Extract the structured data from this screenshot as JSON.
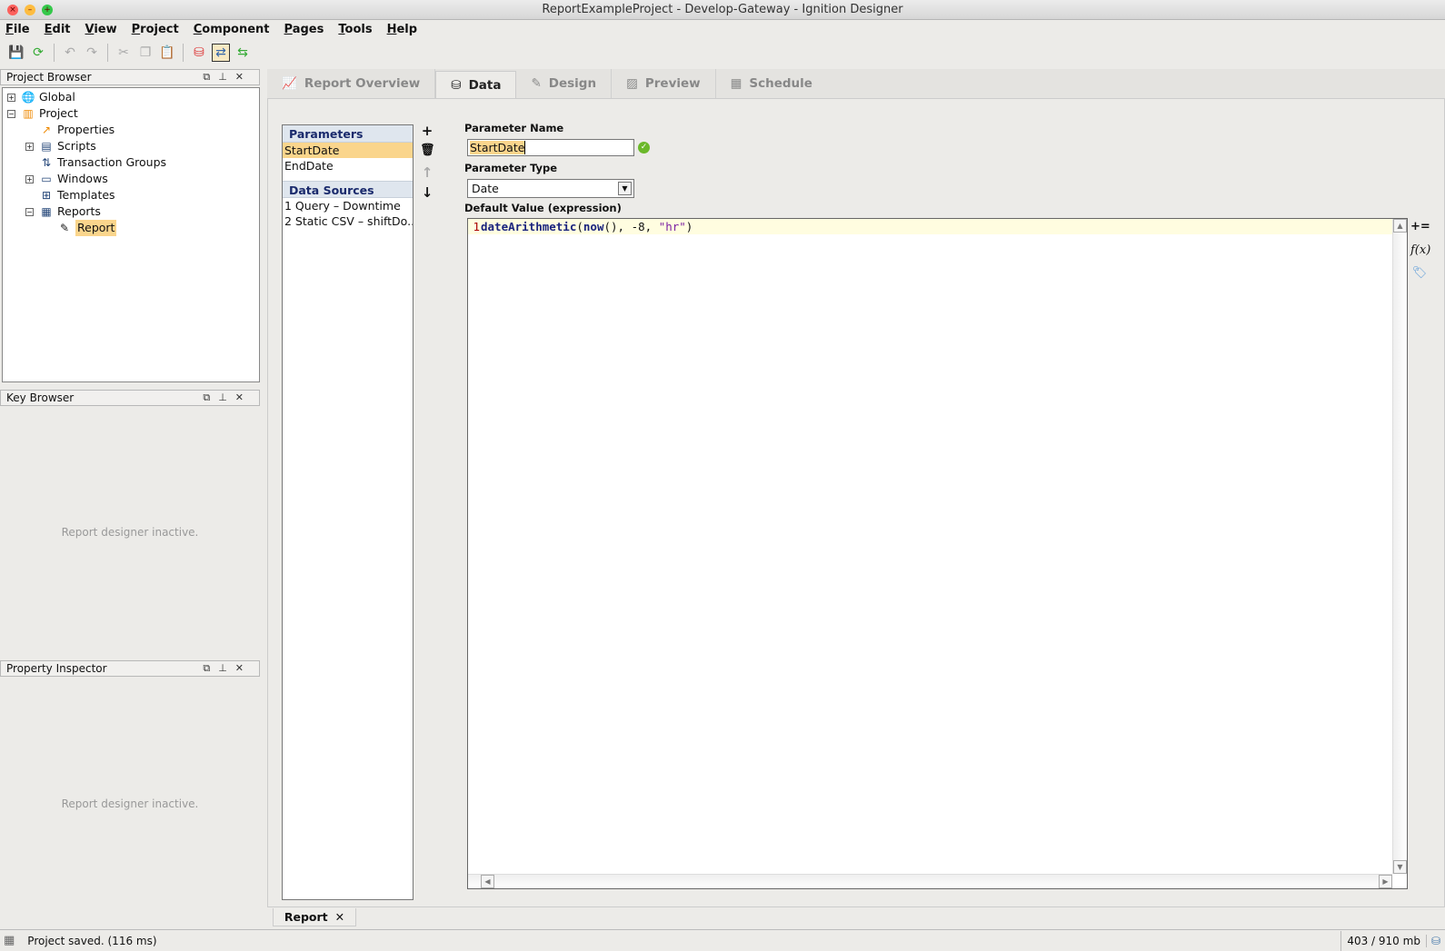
{
  "window": {
    "title": "ReportExampleProject - Develop-Gateway - Ignition Designer"
  },
  "menu": [
    "File",
    "Edit",
    "View",
    "Project",
    "Component",
    "Pages",
    "Tools",
    "Help"
  ],
  "panels": {
    "project_browser": {
      "title": "Project Browser",
      "tree": [
        {
          "label": "Global",
          "icon": "globe-icon"
        },
        {
          "label": "Project",
          "icon": "project-icon"
        },
        {
          "label": "Properties",
          "icon": "properties-icon"
        },
        {
          "label": "Scripts",
          "icon": "scripts-icon"
        },
        {
          "label": "Transaction Groups",
          "icon": "transaction-groups-icon"
        },
        {
          "label": "Windows",
          "icon": "windows-icon"
        },
        {
          "label": "Templates",
          "icon": "templates-icon"
        },
        {
          "label": "Reports",
          "icon": "reports-icon"
        },
        {
          "label": "Report",
          "icon": "report-icon",
          "selected": true
        }
      ]
    },
    "key_browser": {
      "title": "Key Browser",
      "message": "Report designer inactive."
    },
    "property_inspector": {
      "title": "Property Inspector",
      "message": "Report designer inactive."
    }
  },
  "tabs": [
    {
      "label": "Report Overview",
      "icon": "report-overview-icon"
    },
    {
      "label": "Data",
      "icon": "database-icon",
      "active": true
    },
    {
      "label": "Design",
      "icon": "pencil-icon"
    },
    {
      "label": "Preview",
      "icon": "image-icon"
    },
    {
      "label": "Schedule",
      "icon": "calendar-icon"
    }
  ],
  "data_tab": {
    "parameters_header": "Parameters",
    "parameters": [
      "StartDate",
      "EndDate"
    ],
    "selected_parameter": "StartDate",
    "data_sources_header": "Data Sources",
    "data_sources": [
      "1 Query – Downtime",
      "2 Static CSV – shiftDo..."
    ],
    "param_name_label": "Parameter Name",
    "param_name_value": "StartDate",
    "param_type_label": "Parameter Type",
    "param_type_value": "Date",
    "default_value_label": "Default Value (expression)",
    "code": {
      "line_number": "1",
      "fn": "dateArithmetic",
      "open": "(",
      "inner_fn": "now",
      "rest": "(), -8, ",
      "str": "\"hr\"",
      "close": ")"
    }
  },
  "doc_tab": {
    "label": "Report"
  },
  "status": {
    "message": "Project saved. (116 ms)",
    "memory": "403 / 910 mb"
  },
  "colors": {
    "selection": "#fad58c",
    "list_header": "#dfe6ee",
    "code_bg": "#fffde0"
  }
}
